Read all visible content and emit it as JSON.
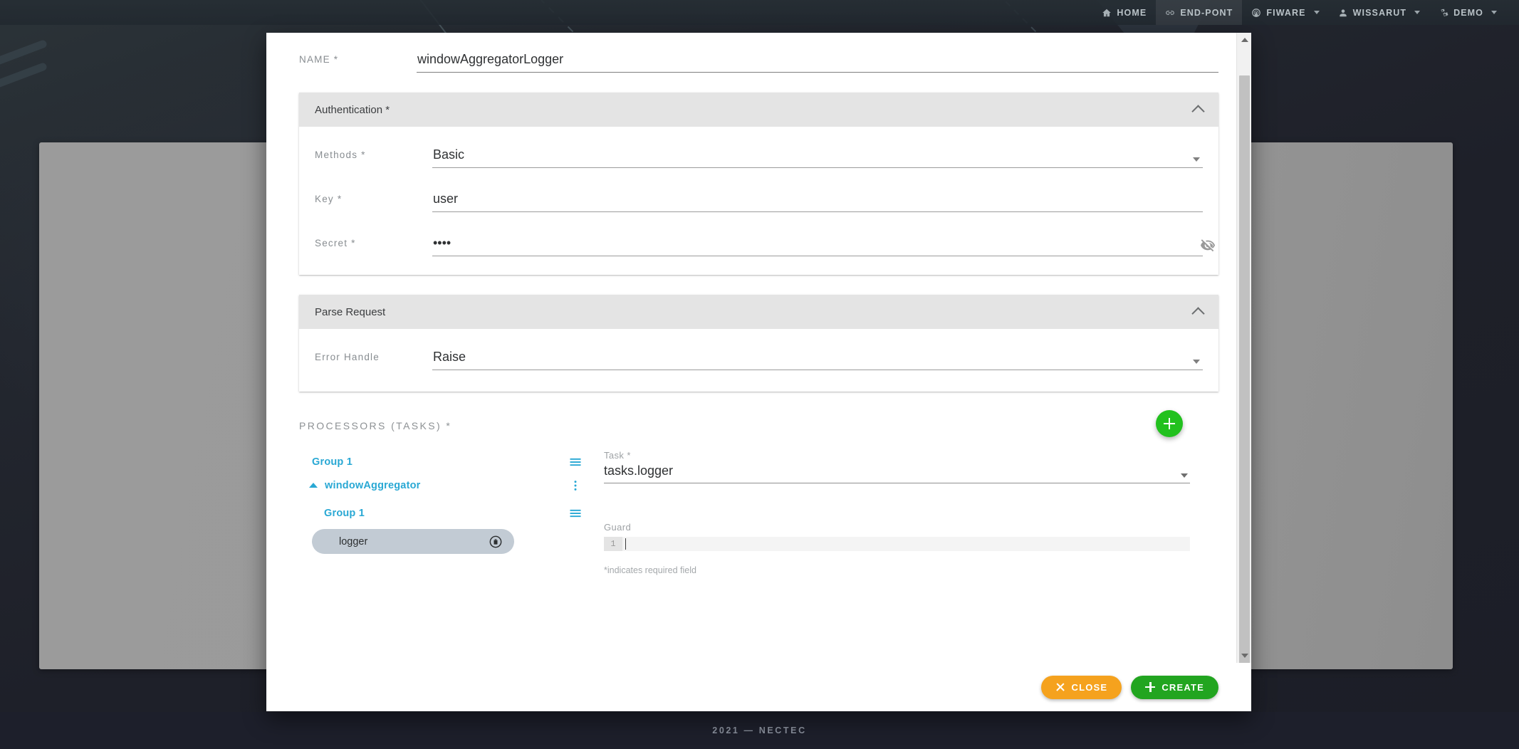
{
  "topnav": {
    "items": [
      {
        "label": "HOME",
        "icon": "home-icon",
        "active": false,
        "caret": false
      },
      {
        "label": "END-PONT",
        "icon": "link-icon",
        "active": true,
        "caret": false
      },
      {
        "label": "FIWARE",
        "icon": "fiware-icon",
        "active": false,
        "caret": true
      },
      {
        "label": "WISSARUT",
        "icon": "person-icon",
        "active": false,
        "caret": true
      },
      {
        "label": "DEMO",
        "icon": "gears-icon",
        "active": false,
        "caret": true
      }
    ]
  },
  "footer": {
    "text": "2021 — NECTEC"
  },
  "dialog": {
    "name_field": {
      "label": "NAME *",
      "value": "windowAggregatorLogger"
    },
    "authentication": {
      "title": "Authentication *",
      "expanded": true,
      "methods": {
        "label": "Methods *",
        "value": "Basic"
      },
      "key": {
        "label": "Key *",
        "value": "user"
      },
      "secret": {
        "label": "Secret *",
        "value": "••••",
        "toggle_icon": "eye-off-icon"
      }
    },
    "parse_request": {
      "title": "Parse Request",
      "expanded": true,
      "error_handle": {
        "label": "Error Handle",
        "value": "Raise"
      }
    },
    "processors": {
      "title": "PROCESSORS (TASKS) *",
      "add_button": "+",
      "tree": [
        {
          "label": "Group 1",
          "level": 1,
          "kind": "group",
          "menu_icon": "hamburger-icon"
        },
        {
          "label": "windowAggregator",
          "level": 2,
          "kind": "node",
          "menu_icon": "kebab-icon",
          "expander": "caret-up-icon"
        },
        {
          "label": "Group 1",
          "level": 3,
          "kind": "group",
          "menu_icon": "hamburger-icon"
        },
        {
          "label": "logger",
          "level": 3,
          "kind": "chip",
          "menu_icon": "trash-icon",
          "selected": true
        }
      ],
      "task": {
        "label": "Task *",
        "value": "tasks.logger"
      },
      "guard": {
        "label": "Guard",
        "value": "",
        "line_number": "1"
      },
      "required_note": "*indicates required field"
    },
    "actions": {
      "close": {
        "label": "CLOSE",
        "icon": "close-x-icon",
        "color": "#f5a21e"
      },
      "create": {
        "label": "CREATE",
        "icon": "plus-icon",
        "color": "#22a520"
      }
    }
  },
  "colors": {
    "accent_blue": "#29a8d4",
    "orange": "#f5a21e",
    "green": "#22a520",
    "panel_header": "#e4e4e4",
    "chip": "#c2cbd4"
  }
}
